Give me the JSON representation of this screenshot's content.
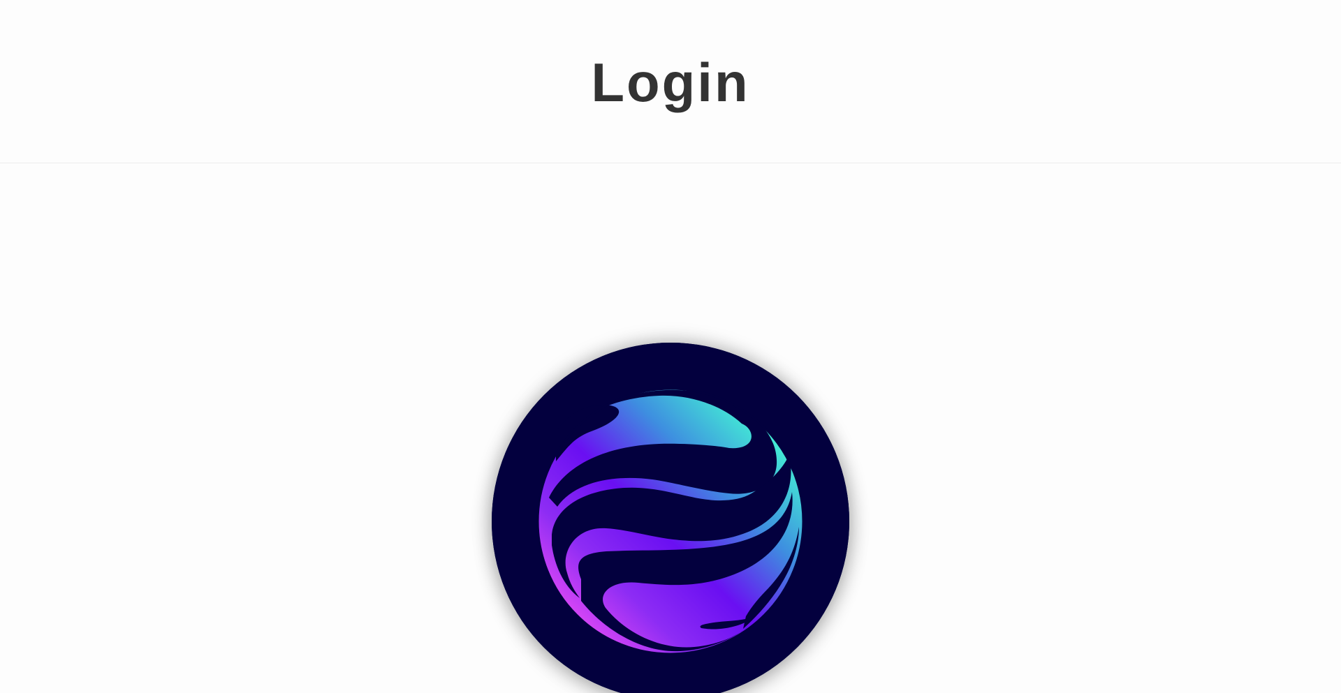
{
  "header": {
    "title": "Login"
  },
  "logo": {
    "icon": "gradient-sphere-logo-icon",
    "colors": {
      "disc": "#03003e",
      "cyan": "#44f2d4",
      "blue": "#3e8ee0",
      "violet": "#6a0ff2",
      "magenta": "#d746f5"
    }
  }
}
